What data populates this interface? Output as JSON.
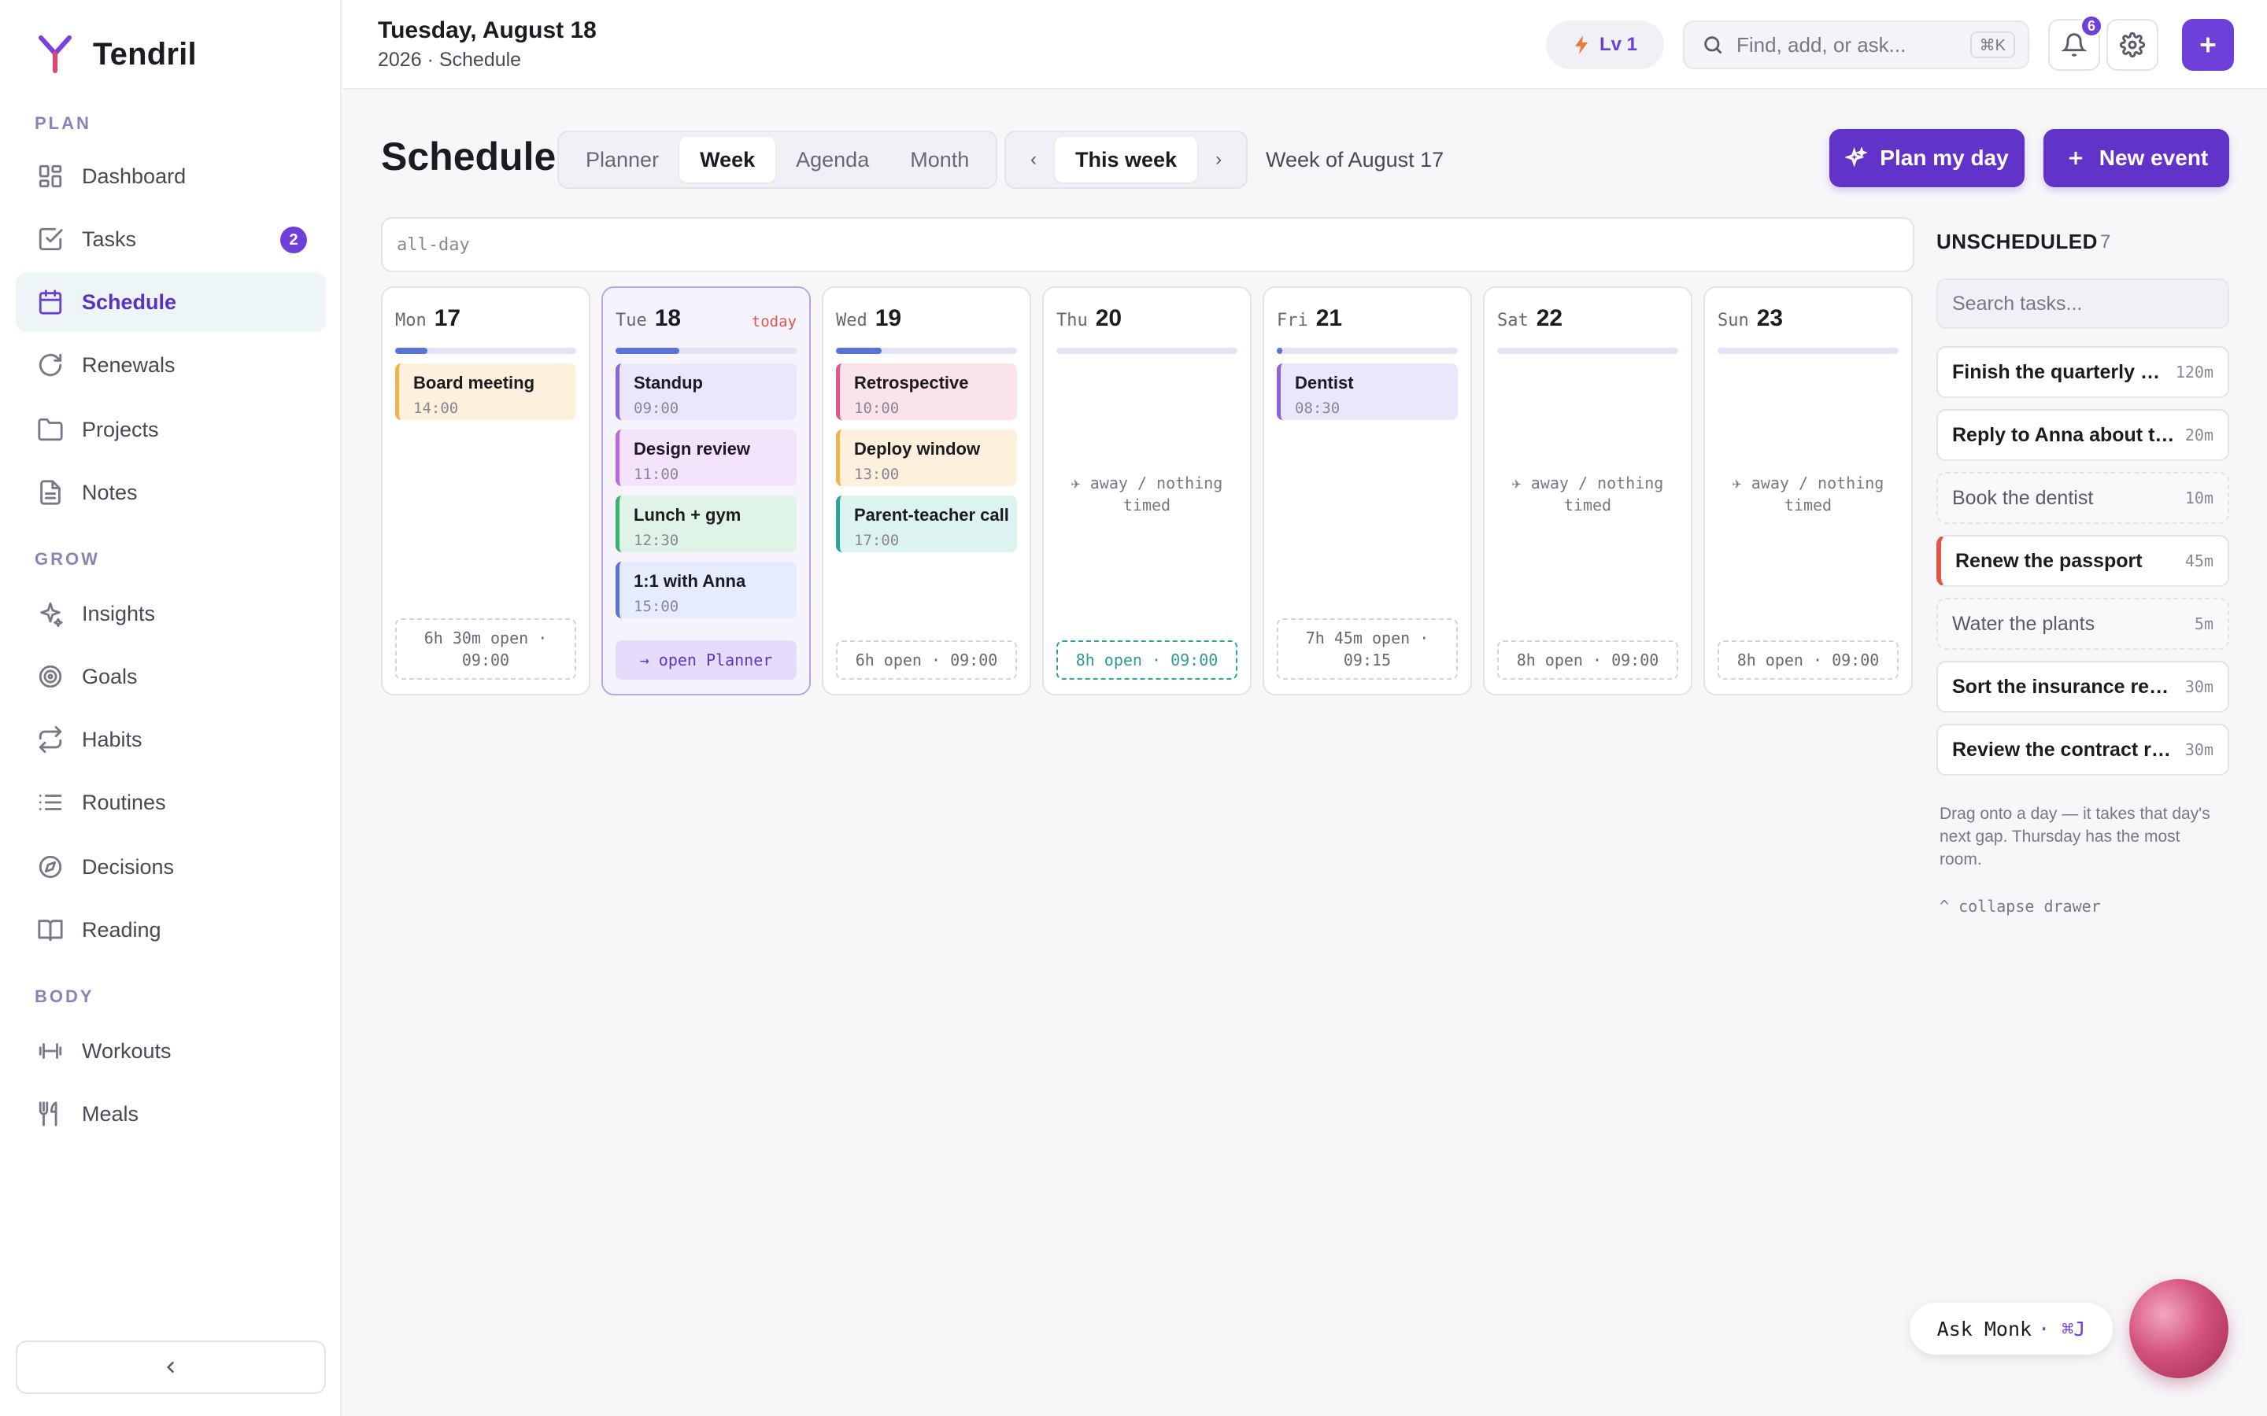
{
  "app": {
    "name": "Tendril"
  },
  "sidebar": {
    "sections": {
      "plan": "PLAN",
      "grow": "GROW",
      "body": "BODY"
    },
    "items": [
      {
        "label": "Dashboard",
        "icon": "grid-icon"
      },
      {
        "label": "Tasks",
        "icon": "checkbox-icon",
        "badge": "2"
      },
      {
        "label": "Schedule",
        "icon": "calendar-icon",
        "active": true
      },
      {
        "label": "Renewals",
        "icon": "refresh-icon"
      },
      {
        "label": "Projects",
        "icon": "folder-icon"
      },
      {
        "label": "Notes",
        "icon": "document-icon"
      },
      {
        "label": "Insights",
        "icon": "sparkle-icon"
      },
      {
        "label": "Goals",
        "icon": "target-icon"
      },
      {
        "label": "Habits",
        "icon": "repeat-icon"
      },
      {
        "label": "Routines",
        "icon": "list-icon"
      },
      {
        "label": "Decisions",
        "icon": "compass-icon"
      },
      {
        "label": "Reading",
        "icon": "book-icon"
      },
      {
        "label": "Workouts",
        "icon": "dumbbell-icon"
      },
      {
        "label": "Meals",
        "icon": "utensils-icon"
      }
    ]
  },
  "topbar": {
    "date_title": "Tuesday, August 18",
    "date_sub": "2026 · Schedule",
    "level": "Lv 1",
    "search_placeholder": "Find, add, or ask...",
    "search_shortcut": "⌘K",
    "notifications_count": "6"
  },
  "schedule": {
    "title": "Schedule",
    "views": [
      "Planner",
      "Week",
      "Agenda",
      "Month"
    ],
    "selected_view": "Week",
    "prev": "‹",
    "current_range": "This week",
    "next": "›",
    "week_of": "Week of August 17",
    "plan_my_day": "Plan my day",
    "new_event": "New event",
    "all_day_label": "all-day",
    "today_tag": "today",
    "open_planner": "→ open Planner",
    "away_text": "✈ away / nothing timed",
    "colors": {
      "accent": "#6233c9",
      "today_border": "#b7a6ea",
      "best_slot": "#2fa59a"
    },
    "days": [
      {
        "dow": "Mon",
        "num": "17",
        "progress": 0.18,
        "open": "6h 30m open · 09:00",
        "events": [
          {
            "title": "Board meeting",
            "time": "14:00",
            "bg": "#fdf0dc",
            "border": "#f0b24a"
          }
        ]
      },
      {
        "dow": "Tue",
        "num": "18",
        "progress": 0.35,
        "today": true,
        "events": [
          {
            "title": "Standup",
            "time": "09:00",
            "bg": "#ece6fb",
            "border": "#8a63dd"
          },
          {
            "title": "Design review",
            "time": "11:00",
            "bg": "#f4e4fb",
            "border": "#b96ade"
          },
          {
            "title": "Lunch + gym",
            "time": "12:30",
            "bg": "#dff4e6",
            "border": "#37b36a"
          },
          {
            "title": "1:1 with Anna",
            "time": "15:00",
            "bg": "#e5ecfb",
            "border": "#5a73d6"
          }
        ]
      },
      {
        "dow": "Wed",
        "num": "19",
        "progress": 0.25,
        "open": "6h open · 09:00",
        "events": [
          {
            "title": "Retrospective",
            "time": "10:00",
            "bg": "#fbe3ec",
            "border": "#e2568a"
          },
          {
            "title": "Deploy window",
            "time": "13:00",
            "bg": "#fdf0dc",
            "border": "#f0b24a"
          },
          {
            "title": "Parent-teacher call",
            "time": "17:00",
            "bg": "#dcf3ef",
            "border": "#2fa59a"
          }
        ]
      },
      {
        "dow": "Thu",
        "num": "20",
        "progress": 0,
        "open": "8h open · 09:00",
        "best": true,
        "away": true,
        "events": []
      },
      {
        "dow": "Fri",
        "num": "21",
        "progress": 0.03,
        "open": "7h 45m open · 09:15",
        "events": [
          {
            "title": "Dentist",
            "time": "08:30",
            "bg": "#ece6fb",
            "border": "#8a63dd"
          }
        ]
      },
      {
        "dow": "Sat",
        "num": "22",
        "progress": 0,
        "open": "8h open · 09:00",
        "away": true,
        "events": []
      },
      {
        "dow": "Sun",
        "num": "23",
        "progress": 0,
        "open": "8h open · 09:00",
        "away": true,
        "events": []
      }
    ]
  },
  "unscheduled": {
    "title": "UNSCHEDULED",
    "count": "7",
    "search_placeholder": "Search tasks...",
    "tasks": [
      {
        "name": "Finish the quarterly report",
        "duration": "120m",
        "style": "normal"
      },
      {
        "name": "Reply to Anna about the offsite",
        "duration": "20m",
        "style": "normal"
      },
      {
        "name": "Book the dentist",
        "duration": "10m",
        "style": "muted"
      },
      {
        "name": "Renew the passport",
        "duration": "45m",
        "style": "urgent"
      },
      {
        "name": "Water the plants",
        "duration": "5m",
        "style": "muted"
      },
      {
        "name": "Sort the insurance renewal",
        "duration": "30m",
        "style": "normal"
      },
      {
        "name": "Review the contract redlines",
        "duration": "30m",
        "style": "normal"
      }
    ],
    "hint": "Drag onto a day — it takes that day's next gap. Thursday has the most room.",
    "collapse": "^ collapse drawer"
  },
  "assistant": {
    "label": "Ask Monk",
    "shortcut": "· ⌘J"
  }
}
